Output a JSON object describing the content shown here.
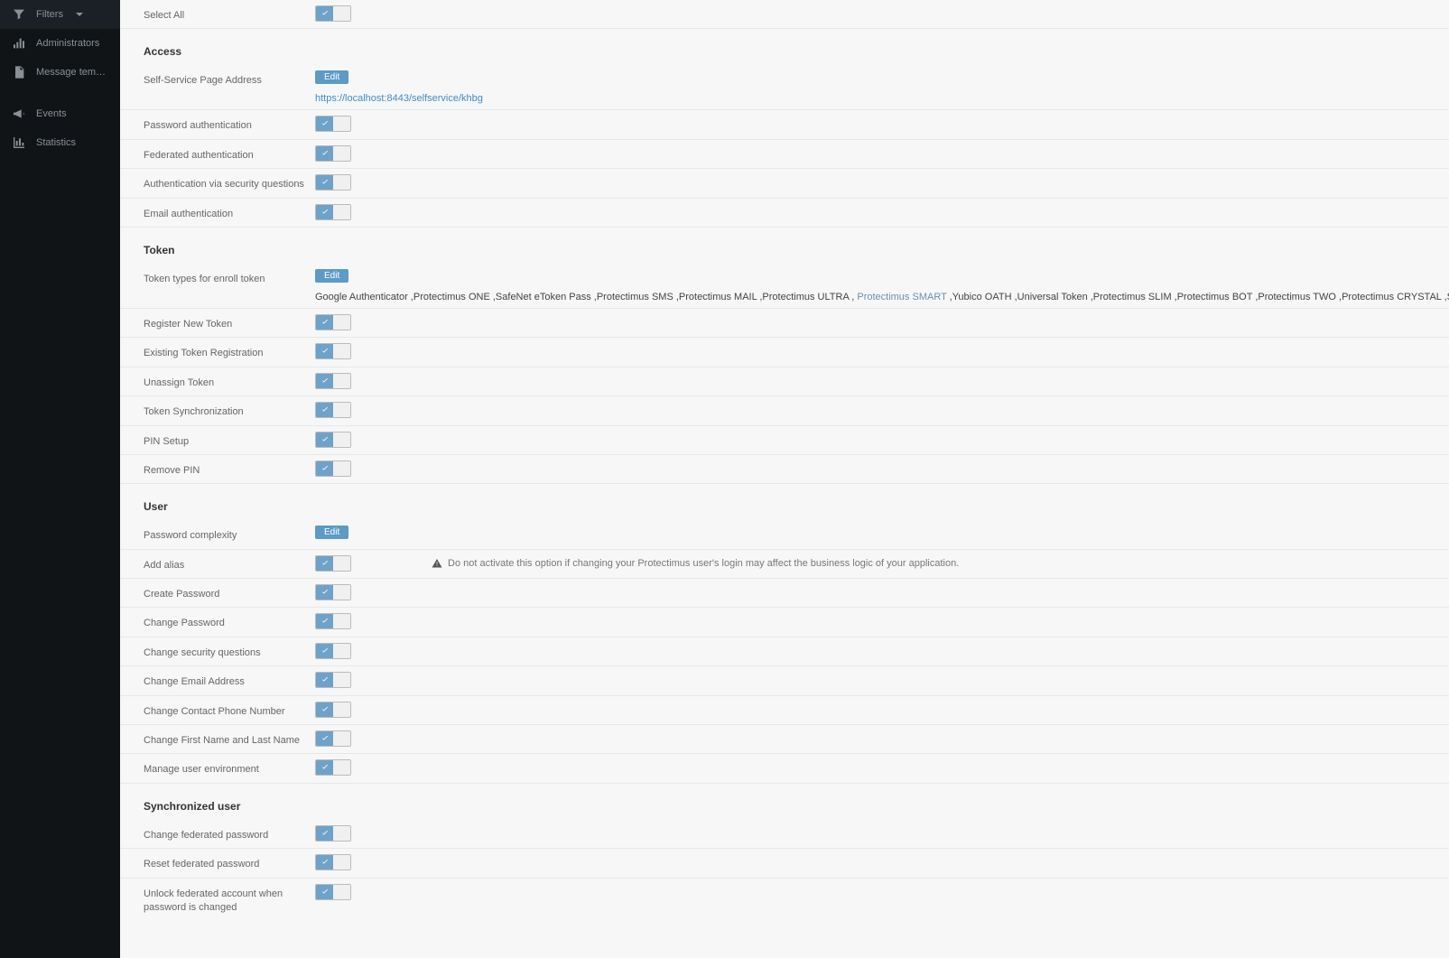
{
  "sidebar": {
    "filters": "Filters",
    "administrators": "Administrators",
    "message_templates": "Message templates",
    "events": "Events",
    "statistics": "Statistics"
  },
  "edit_label": "Edit",
  "sections": {
    "general": {
      "select_all": "Select All"
    },
    "access": {
      "heading": "Access",
      "self_service_label": "Self-Service Page Address",
      "self_service_url": "https://localhost:8443/selfservice/khbg",
      "password_auth": "Password authentication",
      "federated_auth": "Federated authentication",
      "security_q": "Authentication via security questions",
      "email_auth": "Email authentication"
    },
    "token": {
      "heading": "Token",
      "types_label": "Token types for enroll token",
      "types_value_pre": "Google Authenticator ,Protectimus ONE ,SafeNet eToken Pass ,Protectimus SMS ,Protectimus MAIL ,Protectimus ULTRA ,",
      "types_value_linked": " Protectimus SMART ",
      "types_value_post": ",Yubico OATH ,Universal Token ,Protectimus SLIM ,Protectimus BOT ,Protectimus TWO ,Protectimus CRYSTAL ,Shark",
      "register_new": "Register New Token",
      "existing_reg": "Existing Token Registration",
      "unassign": "Unassign Token",
      "sync": "Token Synchronization",
      "pin_setup": "PIN Setup",
      "remove_pin": "Remove PIN"
    },
    "user": {
      "heading": "User",
      "pw_complexity": "Password complexity",
      "add_alias": "Add alias",
      "add_alias_note": "Do not activate this option if changing your Protectimus user's login may affect the business logic of your application.",
      "create_pw": "Create Password",
      "change_pw": "Change Password",
      "change_sq": "Change security questions",
      "change_email": "Change Email Address",
      "change_phone": "Change Contact Phone Number",
      "change_name": "Change First Name and Last Name",
      "manage_env": "Manage user environment"
    },
    "sync_user": {
      "heading": "Synchronized user",
      "change_fed_pw": "Change federated password",
      "reset_fed_pw": "Reset federated password",
      "unlock_fed": "Unlock federated account when password is changed"
    }
  }
}
